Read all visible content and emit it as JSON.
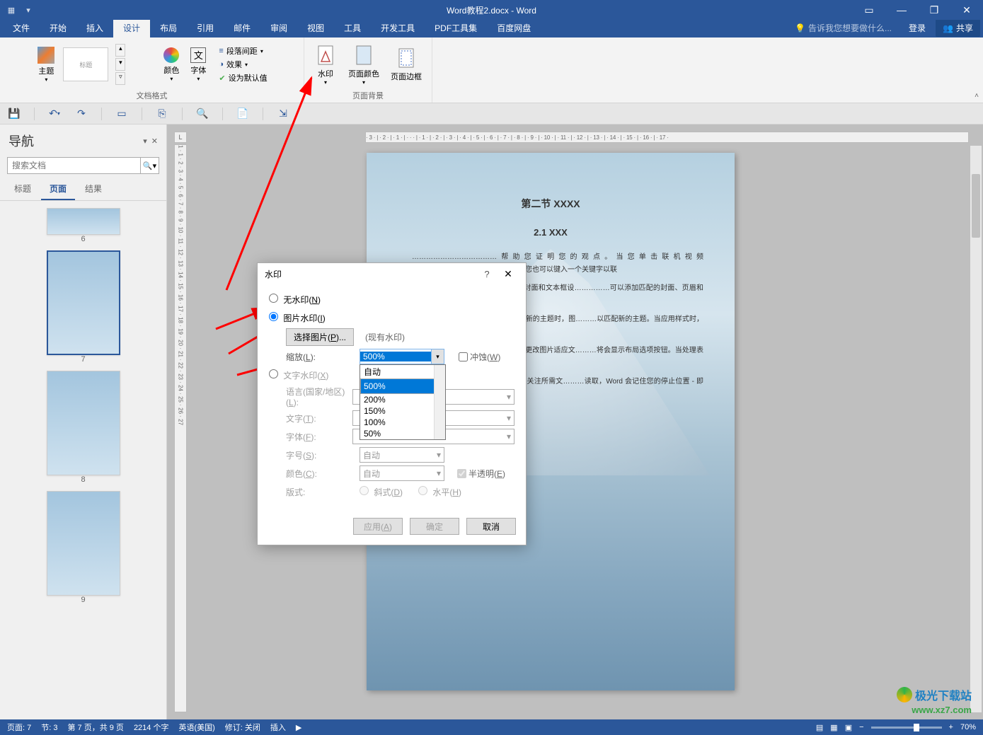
{
  "titlebar": {
    "title": "Word教程2.docx - Word"
  },
  "ribbon": {
    "tabs": [
      "文件",
      "开始",
      "插入",
      "设计",
      "布局",
      "引用",
      "邮件",
      "审阅",
      "视图",
      "工具",
      "开发工具",
      "PDF工具集",
      "百度网盘"
    ],
    "active_tab": "设计",
    "tell_me": "告诉我您想要做什么...",
    "login": "登录",
    "share": "共享"
  },
  "design": {
    "themes_label": "主题",
    "colors": "颜色",
    "fonts": "字体",
    "paragraph_spacing": "段落间距",
    "effects": "效果",
    "set_default": "设为默认值",
    "group1_label": "文档格式",
    "watermark": "水印",
    "page_color": "页面颜色",
    "page_border": "页面边框",
    "group2_label": "页面背景"
  },
  "nav": {
    "title": "导航",
    "search_placeholder": "搜索文档",
    "tabs": [
      "标题",
      "页面",
      "结果"
    ],
    "active": "页面",
    "thumbs": [
      "6",
      "7",
      "8",
      "9"
    ]
  },
  "ruler_corner": "L",
  "page": {
    "h2": "第二节  XXXX",
    "h3": "2.1 XXX",
    "p1": "………………………………帮助您证明您的观点。当您单击联机视频时，……………………………进行粘贴。您也可以键入一个关键字以联",
    "p2": "…………Word 提供了页眉、页脚、封面和文本框设……………可以添加匹配的封面、页眉和提要栏。单………新元素。",
    "p3": "…………协调。当您单击设计并选择新的主题时，图………以匹配新的主题。当应用样式时，您的标",
    "p4": "…………在 Word 中保存时间，若要更改图片适应文………将会显示布局选项按钮。当处理表格时，…………加号。",
    "p5": "…………。可以折叠文档某些部分并关注所需文………读取，Word 会记住您的停止位置 - 即使"
  },
  "dialog": {
    "title": "水印",
    "opt_none": "无水印(N)",
    "opt_pic": "图片水印(I)",
    "opt_text": "文字水印(X)",
    "select_pic": "选择图片(P)...",
    "existing": "(现有水印)",
    "scale_label": "缩放(L):",
    "scale_value": "500%",
    "scale_options": [
      "自动",
      "500%",
      "200%",
      "150%",
      "100%",
      "50%"
    ],
    "scale_highlight": "500%",
    "washout": "冲蚀(W)",
    "lang_label": "语言(国家/地区)(L):",
    "text_label": "文字(T):",
    "font_label": "字体(F):",
    "size_label": "字号(S):",
    "size_value": "自动",
    "color_label": "颜色(C):",
    "color_value": "自动",
    "semi": "半透明(E)",
    "layout_label": "版式:",
    "diag": "斜式(D)",
    "horz": "水平(H)",
    "apply": "应用(A)",
    "ok": "确定",
    "cancel": "取消"
  },
  "statusbar": {
    "page_info": "页面: 7",
    "section": "节: 3",
    "page_of": "第 7 页，共 9 页",
    "words": "2214 个字",
    "lang": "英语(美国)",
    "track": "修订: 关闭",
    "insert": "插入",
    "zoom": "70%"
  },
  "brand": {
    "line1": "极光下载站",
    "line2": "www.xz7.com"
  }
}
